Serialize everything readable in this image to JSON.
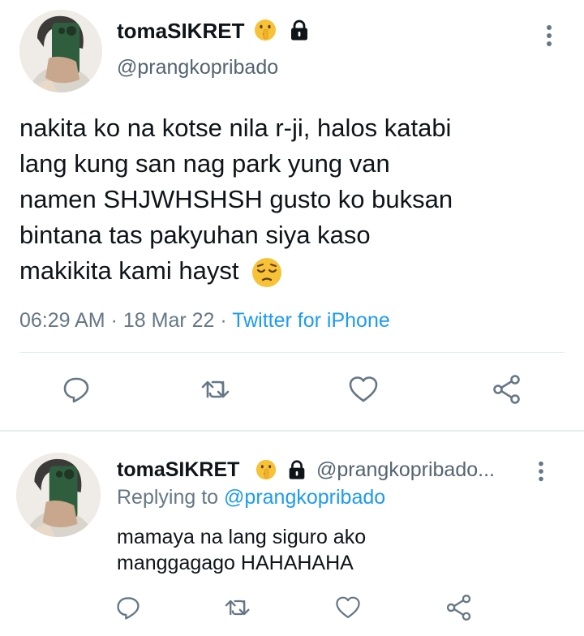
{
  "tweet": {
    "display_name": "tomaSIKRET",
    "name_emoji_icon": "shushing-face-icon",
    "lock_icon": "lock-icon",
    "handle": "@prangkopribado",
    "text_lines": [
      "nakita ko na kotse nila r-ji, halos katabi",
      "lang kung san nag park yung van",
      "namen SHJWHSHSH gusto ko buksan",
      "bintana tas pakyuhan siya kaso",
      "makikita kami hayst"
    ],
    "text_emoji_icon": "pensive-face-icon",
    "time": "06:29 AM",
    "date": "18 Mar 22",
    "dot": "·",
    "source": "Twitter for iPhone",
    "actions": [
      "reply-icon",
      "retweet-icon",
      "like-icon",
      "share-icon"
    ]
  },
  "reply": {
    "display_name": "tomaSIKRET",
    "handle": "@prangkopribado...",
    "replying_prefix": "Replying to",
    "replying_handle": "@prangkopribado",
    "text_lines": [
      "mamaya na lang siguro ako",
      "manggagago HAHAHAHA"
    ]
  },
  "colors": {
    "text": "#0f1419",
    "secondary": "#657786",
    "link": "#1d9bf0",
    "divider": "#e6ecf0"
  }
}
